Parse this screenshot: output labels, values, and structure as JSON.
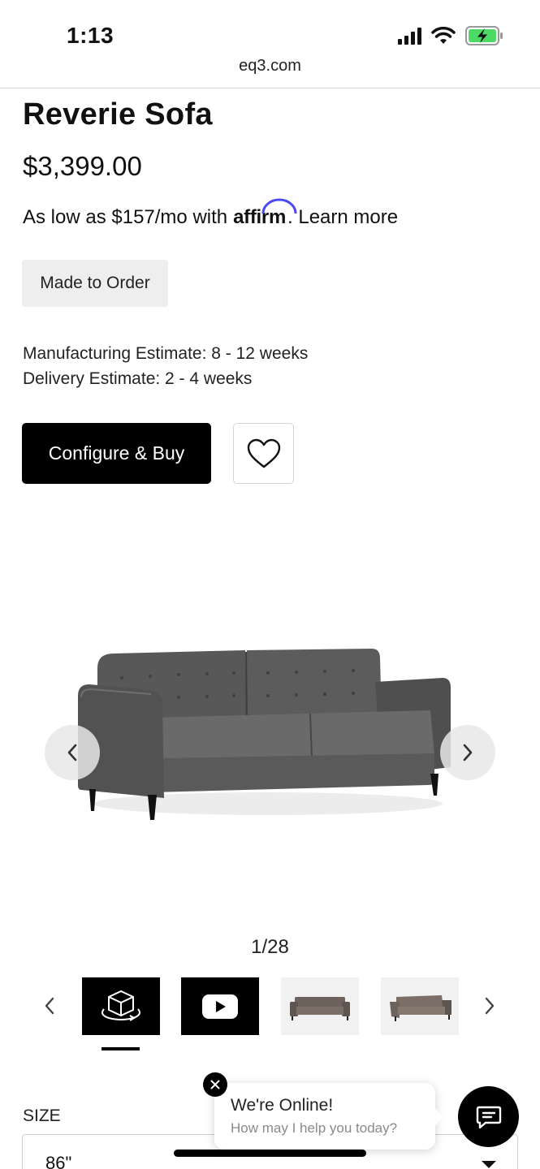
{
  "status_bar": {
    "time": "1:13",
    "url": "eq3.com"
  },
  "product": {
    "title": "Reverie Sofa",
    "price": "$3,399.00",
    "financing_prefix": "As low as $157/mo with",
    "affirm_brand": "affirm",
    "financing_suffix": ". Learn more",
    "badge": "Made to Order",
    "manufacturing_estimate": "Manufacturing Estimate: 8 - 12 weeks",
    "delivery_estimate": "Delivery Estimate: 2 - 4 weeks",
    "configure_label": "Configure & Buy"
  },
  "gallery": {
    "counter": "1/28",
    "thumbnails": [
      {
        "icon": "3d-view-icon"
      },
      {
        "icon": "video-play-icon"
      },
      {
        "icon": "sofa-thumbnail"
      },
      {
        "icon": "sofa-thumbnail"
      }
    ]
  },
  "size": {
    "label": "SIZE",
    "value": "86\""
  },
  "chat": {
    "title": "We're Online!",
    "subtitle": "How may I help you today?"
  },
  "colors": {
    "accent": "#000000",
    "affirm": "#4a4af4",
    "sofa": "#5a5a5a",
    "thumb_sofa": "#6d625c"
  }
}
